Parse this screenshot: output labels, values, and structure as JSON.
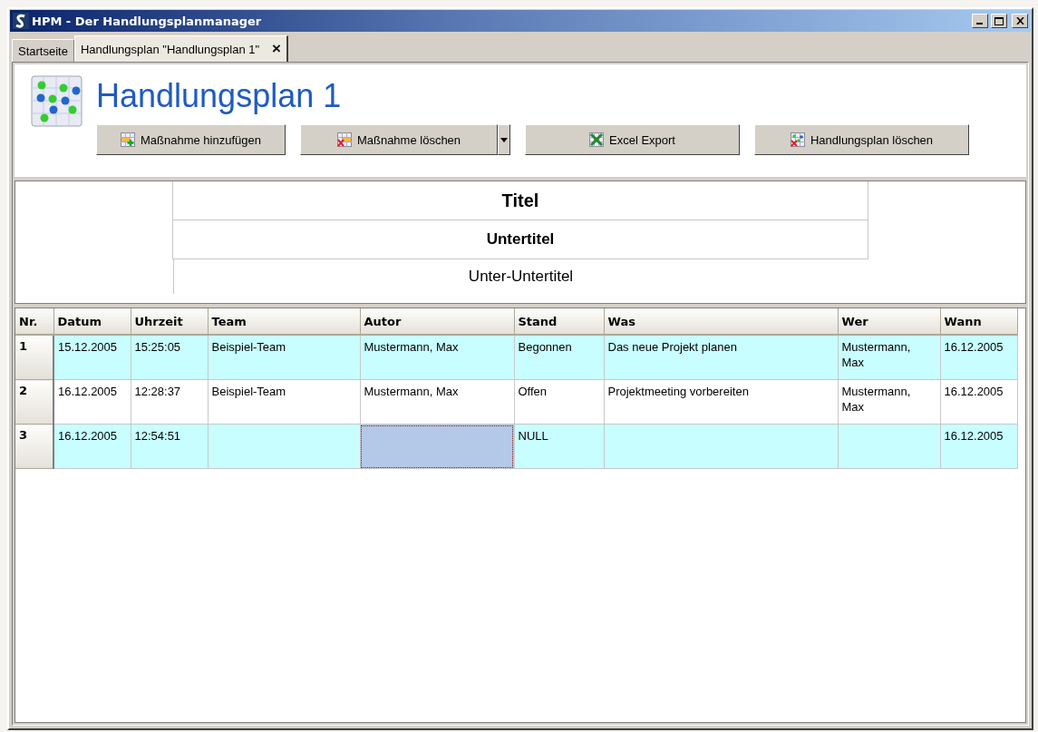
{
  "window": {
    "title": "HPM - Der Handlungsplanmanager"
  },
  "tabs": [
    {
      "label": "Startseite",
      "selected": false
    },
    {
      "label": "Handlungsplan \"Handlungsplan 1\"",
      "selected": true,
      "close": "×"
    }
  ],
  "header": {
    "title": "Handlungsplan 1"
  },
  "buttons": [
    {
      "label": "Maßnahme hinzufügen",
      "kind": "add"
    },
    {
      "label": "Maßnahme löschen",
      "kind": "delete-split"
    },
    {
      "label": "Excel Export",
      "kind": "excel"
    },
    {
      "label": "Handlungsplan löschen",
      "kind": "delete-plan"
    }
  ],
  "titles": {
    "title": "Titel",
    "subtitle": "Untertitel",
    "subsubtitle": "Unter-Untertitel"
  },
  "table": {
    "columns": [
      "Nr.",
      "Datum",
      "Uhrzeit",
      "Team",
      "Autor",
      "Stand",
      "Was",
      "Wer",
      "Wann"
    ],
    "rows": [
      {
        "cells": [
          {
            "text": "1",
            "selected": false
          },
          {
            "text": "15.12.2005",
            "selected": false
          },
          {
            "text": "15:25:05",
            "selected": false
          },
          {
            "text": "Beispiel-Team",
            "selected": false
          },
          {
            "text": "Mustermann, Max",
            "selected": false
          },
          {
            "text": "Begonnen",
            "selected": false
          },
          {
            "text": "Das neue Projekt planen",
            "selected": false
          },
          {
            "text": "Mustermann, Max",
            "selected": false
          },
          {
            "text": "16.12.2005",
            "selected": false
          }
        ]
      },
      {
        "cells": [
          {
            "text": "2",
            "selected": false
          },
          {
            "text": "16.12.2005",
            "selected": false
          },
          {
            "text": "12:28:37",
            "selected": false
          },
          {
            "text": "Beispiel-Team",
            "selected": false
          },
          {
            "text": "Mustermann, Max",
            "selected": false
          },
          {
            "text": "Offen",
            "selected": false
          },
          {
            "text": "Projektmeeting vorbereiten",
            "selected": false
          },
          {
            "text": "Mustermann, Max",
            "selected": false
          },
          {
            "text": "16.12.2005",
            "selected": false
          }
        ]
      },
      {
        "cells": [
          {
            "text": "3",
            "selected": false
          },
          {
            "text": "16.12.2005",
            "selected": false
          },
          {
            "text": "12:54:51",
            "selected": false
          },
          {
            "selected": false
          },
          {
            "selected": true
          },
          {
            "text": "NULL",
            "selected": false
          },
          {
            "selected": false
          },
          {
            "selected": false
          },
          {
            "text": "16.12.2005",
            "selected": false
          }
        ]
      }
    ]
  }
}
